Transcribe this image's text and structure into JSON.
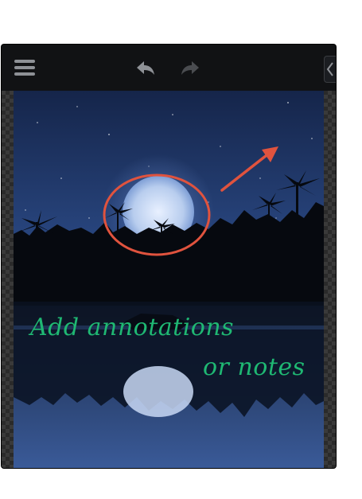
{
  "toolbar": {
    "menu_icon": "hamburger-menu-icon",
    "undo_icon": "undo-arrow-icon",
    "redo_icon": "redo-arrow-icon",
    "side_tab_icon": "chevron-left-icon"
  },
  "annotation": {
    "line1": "Add annotations",
    "line2": "or notes",
    "text_color": "#1fb873",
    "shape_color": "#e0533e"
  }
}
